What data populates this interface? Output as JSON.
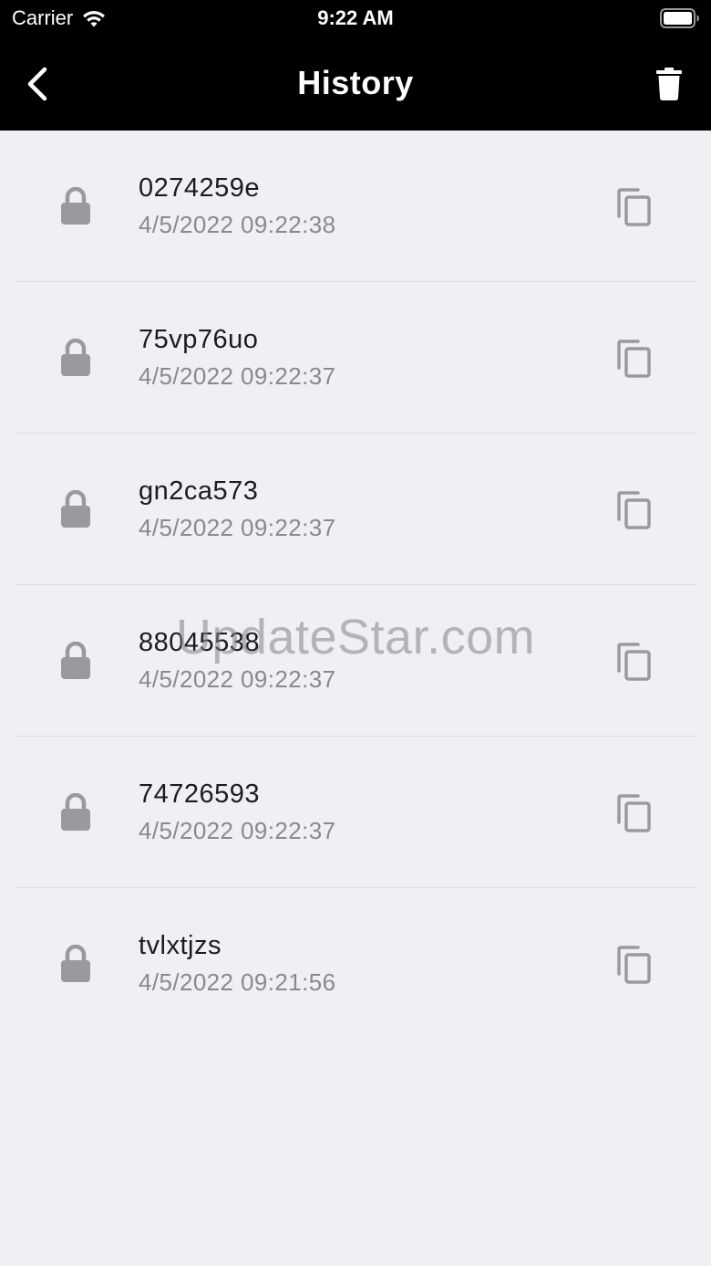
{
  "status_bar": {
    "carrier": "Carrier",
    "time": "9:22 AM"
  },
  "nav": {
    "title": "History"
  },
  "history": [
    {
      "code": "0274259e",
      "timestamp": "4/5/2022 09:22:38"
    },
    {
      "code": "75vp76uo",
      "timestamp": "4/5/2022 09:22:37"
    },
    {
      "code": "gn2ca573",
      "timestamp": "4/5/2022 09:22:37"
    },
    {
      "code": "88045538",
      "timestamp": "4/5/2022 09:22:37"
    },
    {
      "code": "74726593",
      "timestamp": "4/5/2022 09:22:37"
    },
    {
      "code": "tvlxtjzs",
      "timestamp": "4/5/2022 09:21:56"
    }
  ],
  "watermark": "UpdateStar.com",
  "colors": {
    "nav_background": "#000000",
    "list_background": "#efeff4",
    "icon_gray": "#9a9a9e"
  },
  "icons": {
    "back": "chevron-left-icon",
    "trash": "trash-icon",
    "lock": "lock-icon",
    "copy": "copy-icon"
  }
}
